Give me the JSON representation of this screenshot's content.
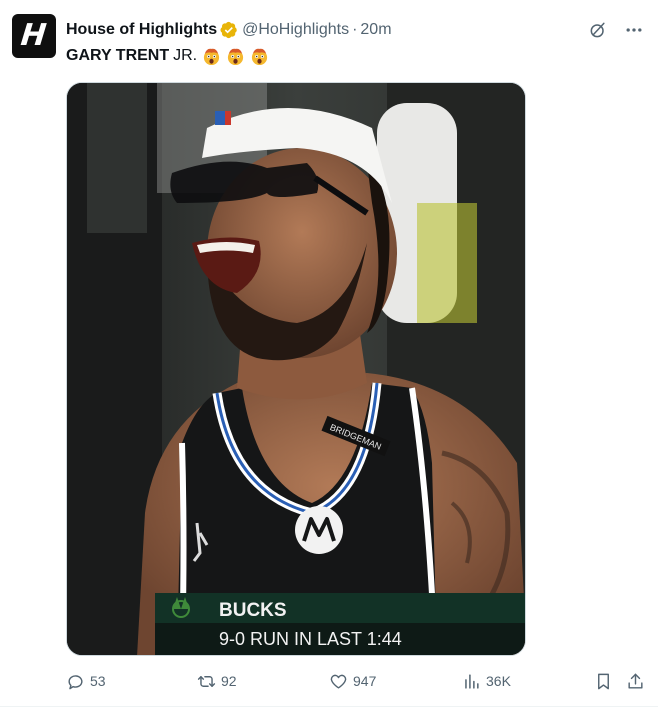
{
  "author": {
    "display_name": "House of Highlights",
    "handle": "@HoHighlights",
    "separator": "·",
    "time": "20m",
    "avatar_letter": "H",
    "verified_color": "#e8b408"
  },
  "tweet": {
    "text_bold": "GARY TRENT",
    "text_regular": "JR.",
    "emoji_count": 3,
    "emoji": "exploding-head"
  },
  "media": {
    "scoreboard_team": "BUCKS",
    "scoreboard_text": "9-0 RUN IN LAST 1:44",
    "jersey_sponsor": "motorola-logo",
    "shirt_patch": "BRIDGEMAN"
  },
  "actions": {
    "replies": "53",
    "retweets": "92",
    "likes": "947",
    "views": "36K"
  },
  "icons": {
    "grok": "grok-icon",
    "more": "more-icon",
    "reply": "reply-icon",
    "retweet": "retweet-icon",
    "like": "heart-icon",
    "views": "views-icon",
    "bookmark": "bookmark-icon",
    "share": "share-icon"
  },
  "colors": {
    "text": "#0f1419",
    "muted": "#536471",
    "divider": "#eff3f4"
  }
}
